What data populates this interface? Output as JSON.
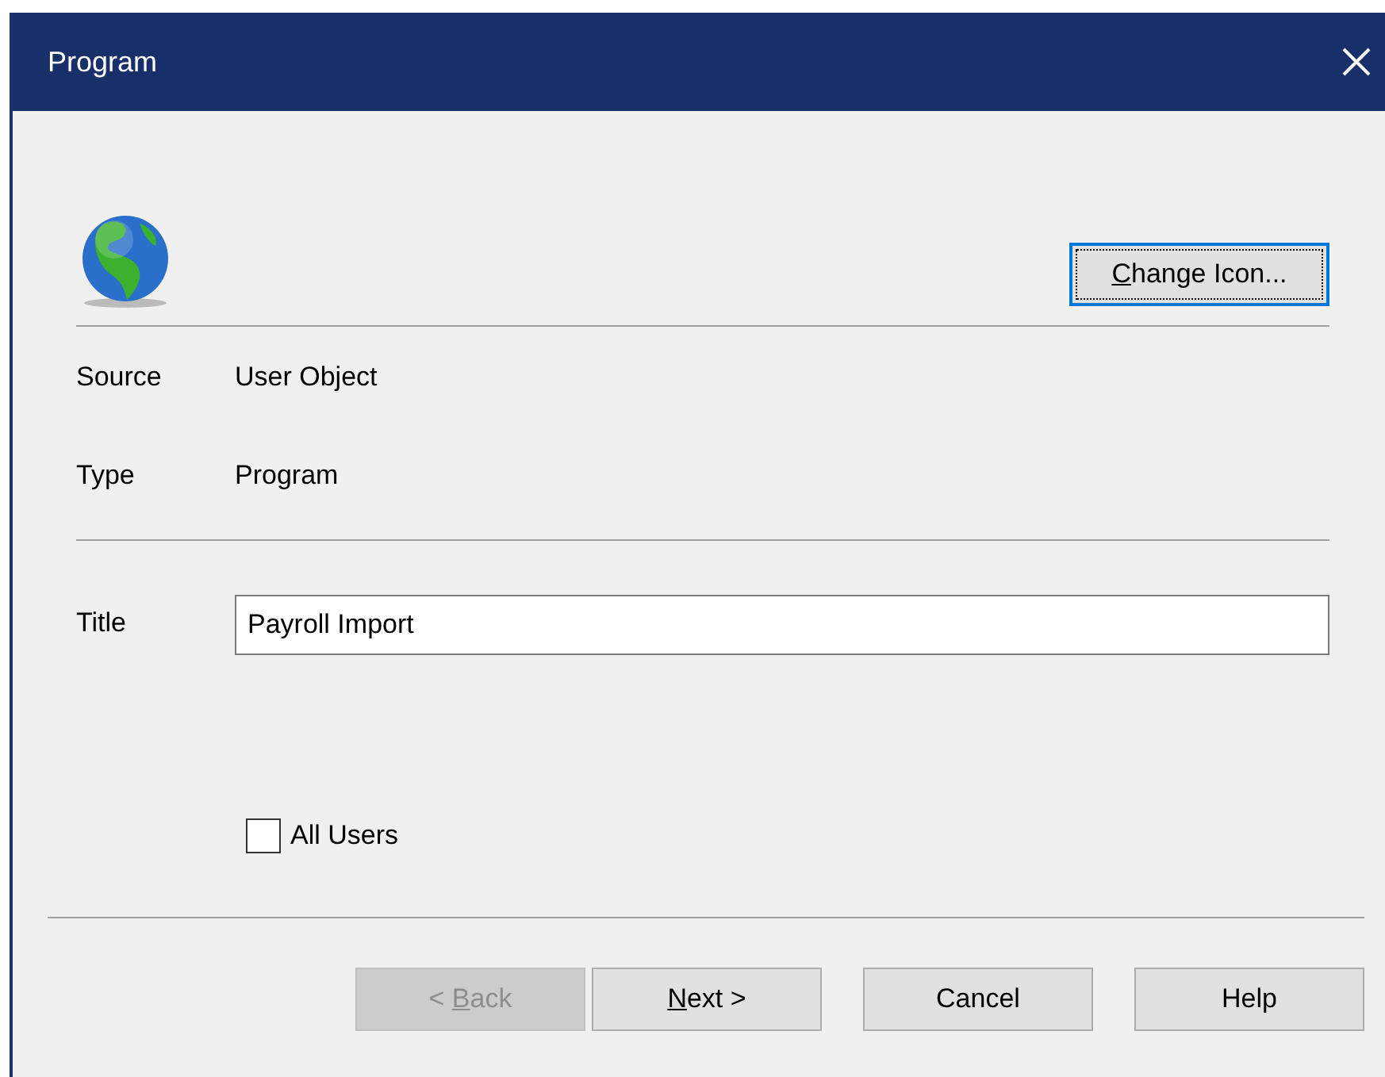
{
  "window": {
    "title": "Program"
  },
  "change_icon_button": {
    "label": [
      {
        "text": "C",
        "access_key": true
      },
      {
        "text": "hange Icon...",
        "access_key": false
      }
    ],
    "focused": true
  },
  "properties": [
    {
      "label": "Source",
      "value": "User Object"
    },
    {
      "label": "Type",
      "value": "Program"
    }
  ],
  "title_field": {
    "label": "Title",
    "value": "Payroll Import"
  },
  "all_users": {
    "label": "All Users",
    "checked": false
  },
  "buttons": [
    {
      "label": [
        {
          "text": "< ",
          "access_key": false
        },
        {
          "text": "B",
          "access_key": true
        },
        {
          "text": "ack",
          "access_key": false
        }
      ],
      "disabled": true
    },
    {
      "label": [
        {
          "text": "N",
          "access_key": true
        },
        {
          "text": "ext >",
          "access_key": false
        }
      ],
      "disabled": false
    },
    {
      "label": [
        {
          "text": "Cancel",
          "access_key": false
        }
      ],
      "disabled": false
    },
    {
      "label": [
        {
          "text": "Help",
          "access_key": false
        }
      ],
      "disabled": false
    }
  ]
}
